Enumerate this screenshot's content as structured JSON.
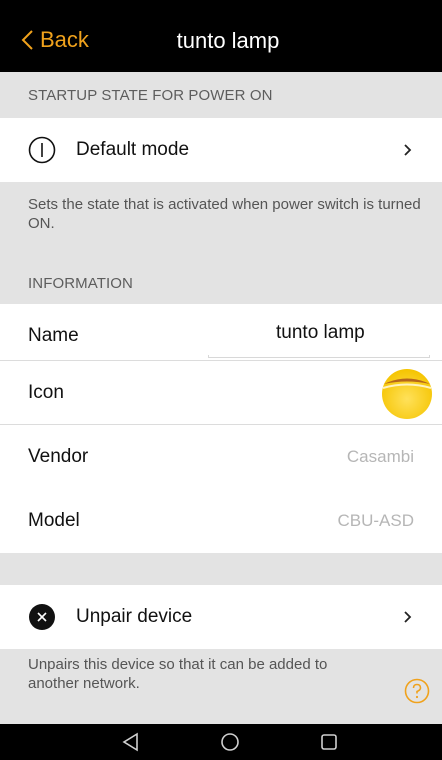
{
  "header": {
    "back_label": "Back",
    "title": "tunto lamp",
    "accent_color": "#f0a21c"
  },
  "startup": {
    "section_title": "STARTUP STATE FOR POWER ON",
    "default_mode_label": "Default mode",
    "default_mode_icon": "power-icon",
    "description": "Sets the state that is activated when power switch is turned ON."
  },
  "information": {
    "section_title": "INFORMATION",
    "name_label": "Name",
    "name_value": "tunto lamp",
    "icon_label": "Icon",
    "icon_name": "lamp-icon",
    "vendor_label": "Vendor",
    "vendor_value": "Casambi",
    "model_label": "Model",
    "model_value": "CBU-ASD"
  },
  "unpair": {
    "label": "Unpair device",
    "icon": "close-circle-icon",
    "description": "Unpairs this device so that it can be added to another network."
  },
  "help_icon": "help-icon",
  "nav": {
    "back_icon": "nav-back-icon",
    "home_icon": "nav-home-icon",
    "recents_icon": "nav-recents-icon"
  }
}
